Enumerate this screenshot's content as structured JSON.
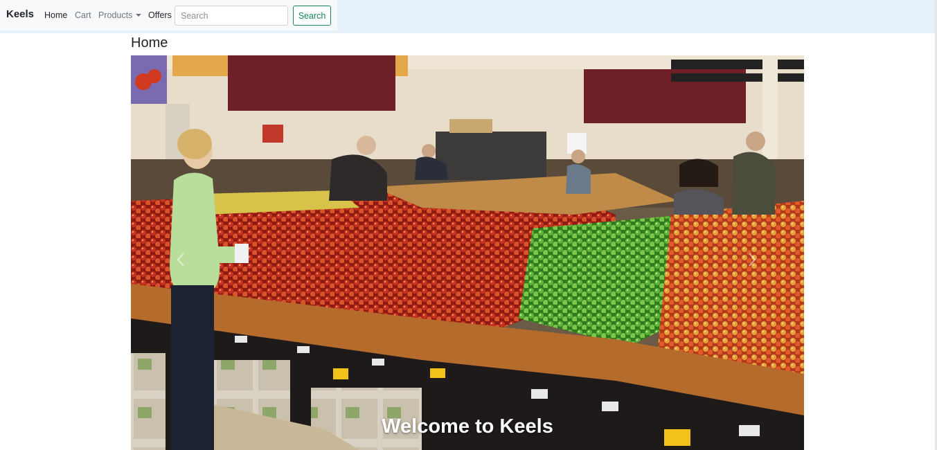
{
  "navbar": {
    "brand": "Keels",
    "links": {
      "home": "Home",
      "cart": "Cart",
      "products": "Products",
      "offers": "Offers"
    },
    "search": {
      "placeholder": "Search",
      "value": "",
      "button_label": "Search"
    }
  },
  "page": {
    "title": "Home"
  },
  "carousel": {
    "caption": "Welcome to Keels",
    "image": "supermarket-produce-aisle-photo",
    "prev_icon": "chevron-left-icon",
    "next_icon": "chevron-right-icon"
  },
  "colors": {
    "topbar": "#e7f1fb",
    "navbar": "#f8f9fa",
    "search_button": "#198754"
  }
}
